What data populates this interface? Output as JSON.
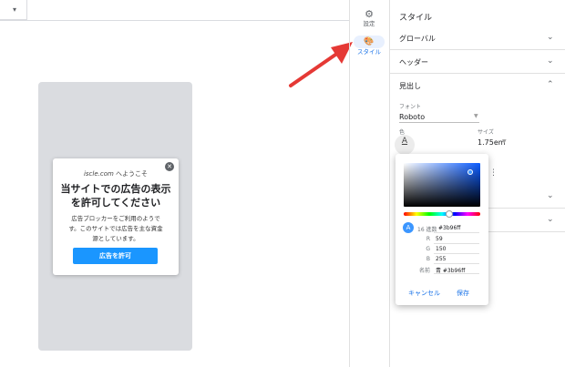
{
  "preview": {
    "welcome_site": "iscle.com",
    "welcome_suffix": " へようこそ",
    "title_line1": "当サイトでの広告の表示",
    "title_line2": "を許可してください",
    "body_line1": "広告ブロッカーをご利用のようで",
    "body_line2": "す。このサイトでは広告を主な資金",
    "body_line3": "源としています。",
    "allow_button": "広告を許可",
    "close_glyph": "✕"
  },
  "rail": {
    "settings_label": "設定",
    "style_label": "スタイル",
    "settings_icon": "⚙",
    "style_icon": "🎨"
  },
  "panel": {
    "title": "スタイル",
    "sections": {
      "global": "グローバル",
      "header": "ヘッダー",
      "heading": "見出し"
    },
    "font_label": "フォント",
    "font_value": "Roboto",
    "color_label": "色",
    "size_label": "サイズ",
    "size_value": "1.75em"
  },
  "picker": {
    "swatch_letter": "A",
    "hex_label": "16 進数",
    "hex_value": "#3b96ff",
    "r_label": "R",
    "r_value": "59",
    "g_label": "G",
    "g_value": "150",
    "b_label": "B",
    "b_value": "255",
    "name_label": "名前",
    "name_value": "青 #3b96ff",
    "cancel": "キャンセル",
    "save": "保存"
  },
  "colors": {
    "accent": "#1a73e8",
    "selected_color": "#3b96ff",
    "allow_button": "#1a96ff",
    "arrow": "#e53935"
  }
}
